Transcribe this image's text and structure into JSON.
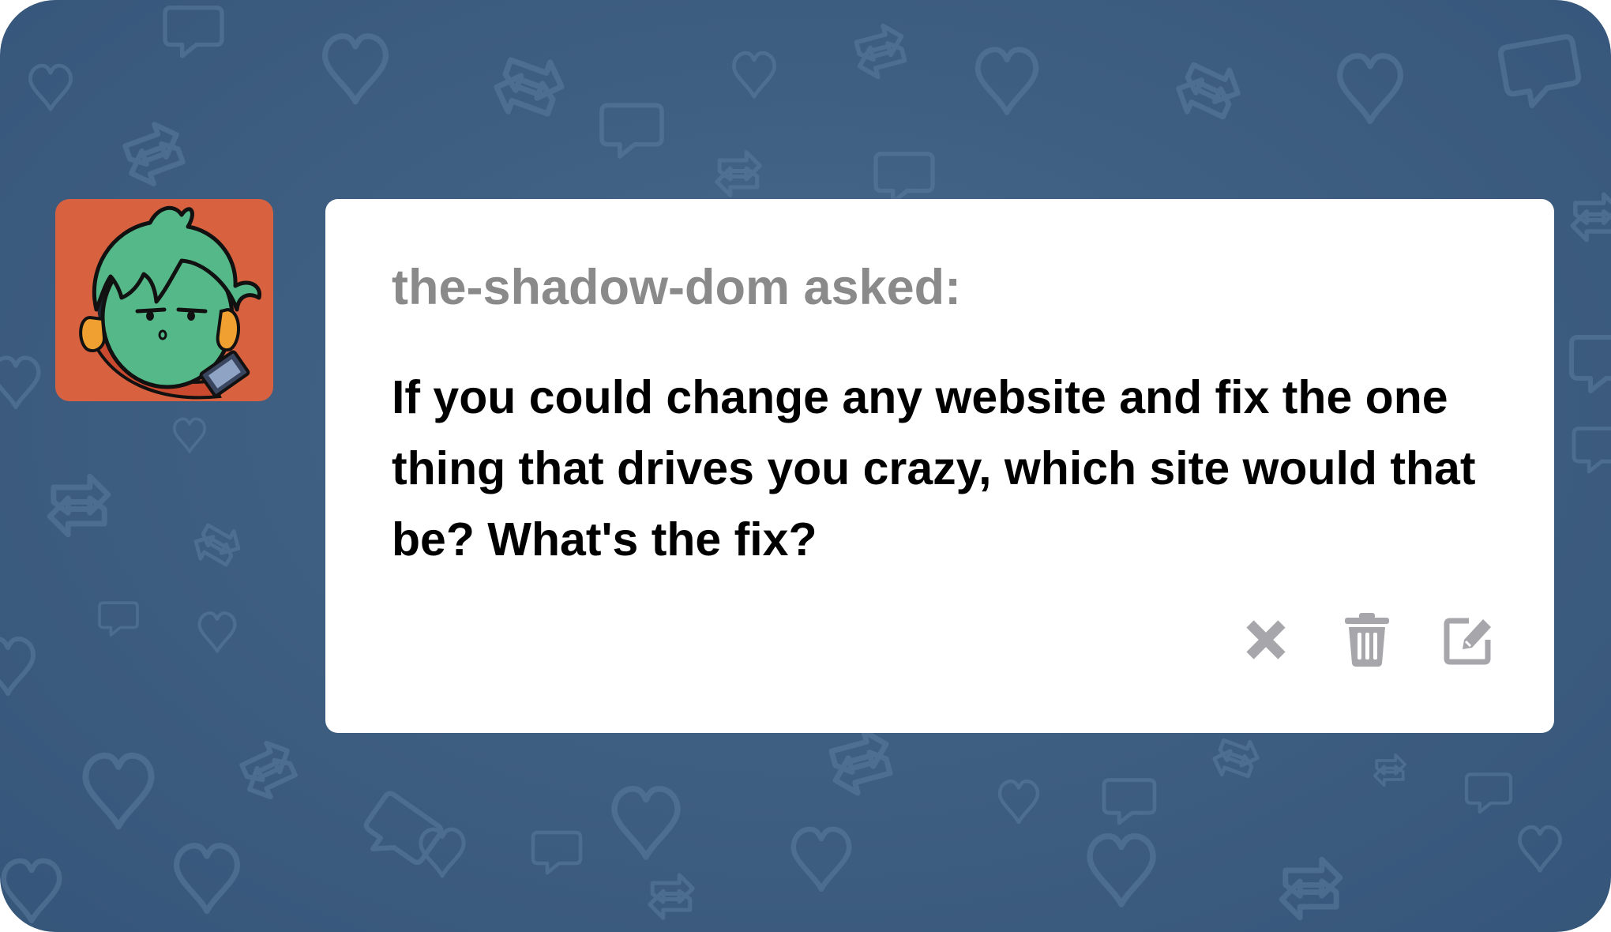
{
  "post": {
    "asker_line": "the-shadow-dom asked:",
    "question": "If you could change any website and fix the one thing that drives you crazy, which site would that be? What's the fix?"
  },
  "avatar": {
    "icon": "cartoon-character-avatar",
    "background_color": "#d8613f"
  },
  "actions": [
    {
      "icon": "close-icon"
    },
    {
      "icon": "trash-icon"
    },
    {
      "icon": "edit-icon"
    }
  ],
  "colors": {
    "background": "#3f5f82",
    "card": "#ffffff",
    "asker_text": "#8a8a8a",
    "question_text": "#000000",
    "action_icons": "#a7a7ab"
  }
}
